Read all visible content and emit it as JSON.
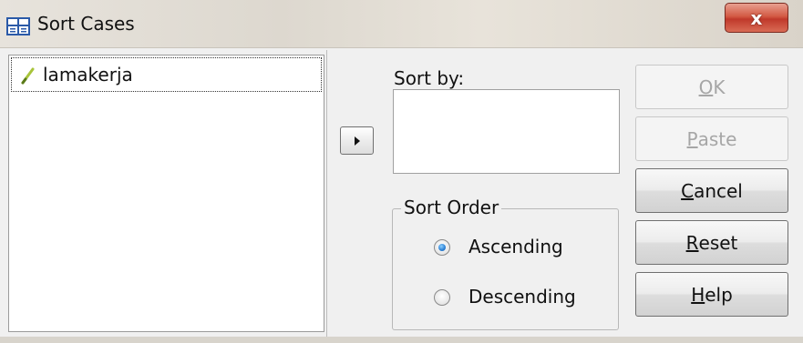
{
  "window": {
    "title": "Sort Cases",
    "close_label": "x",
    "icons": {
      "app": "spss-dataset-icon",
      "close": "close-icon"
    }
  },
  "variables": {
    "items": [
      {
        "label": "lamakerja",
        "icon": "scale-variable-icon"
      }
    ]
  },
  "move_button": {
    "icon": "right-arrow-icon"
  },
  "sort_by": {
    "label": "Sort by:",
    "items": []
  },
  "sort_order": {
    "legend": "Sort Order",
    "options": [
      {
        "label": "Ascending",
        "selected": true
      },
      {
        "label": "Descending",
        "selected": false
      }
    ]
  },
  "buttons": [
    {
      "mnemonic": "O",
      "rest": "K",
      "label": "OK",
      "enabled": false
    },
    {
      "mnemonic": "P",
      "rest": "aste",
      "label": "Paste",
      "enabled": false
    },
    {
      "mnemonic": "C",
      "rest": "ancel",
      "label": "Cancel",
      "enabled": true
    },
    {
      "mnemonic": "R",
      "rest": "eset",
      "label": "Reset",
      "enabled": true
    },
    {
      "mnemonic": "H",
      "rest": "elp",
      "label": "Help",
      "enabled": true
    }
  ],
  "colors": {
    "radio_selected": "#2a7fd4",
    "disabled_text": "#a6a6a6",
    "close_button": "#c0392b"
  }
}
